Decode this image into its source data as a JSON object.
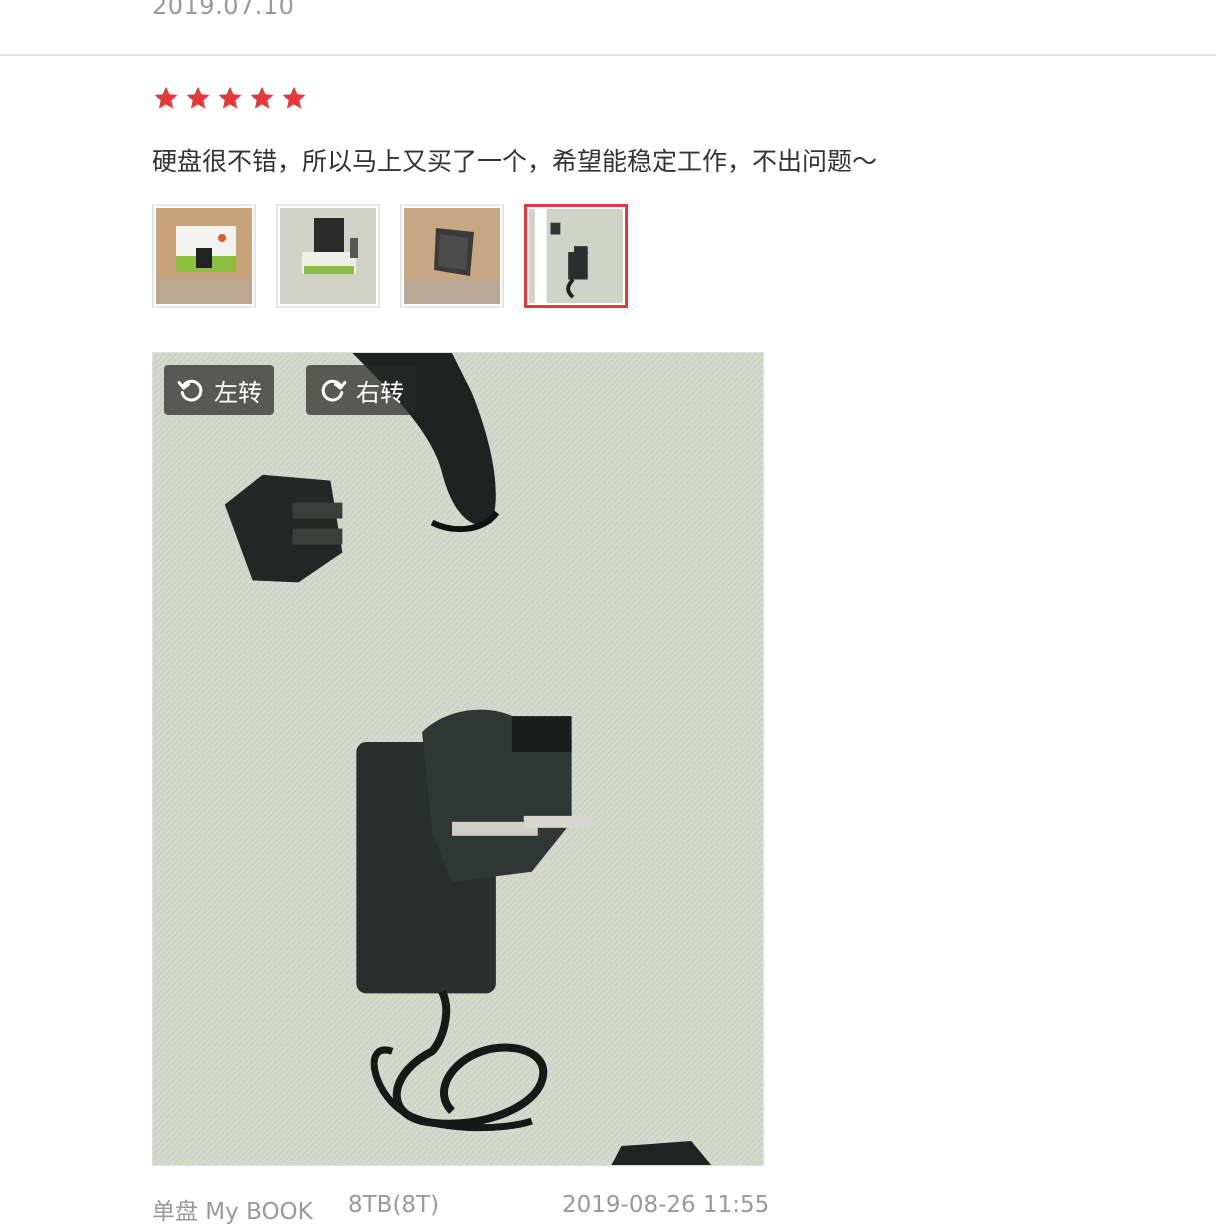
{
  "previous_review": {
    "date": "2019.07.10"
  },
  "review": {
    "rating": 5,
    "star_color": "#e4393c",
    "text": "硬盘很不错，所以马上又买了一个，希望能稳定工作，不出问题～",
    "thumbnails": [
      {
        "name": "thumb-box-front",
        "selected": false
      },
      {
        "name": "thumb-drive-stand",
        "selected": false
      },
      {
        "name": "thumb-drive-closeup",
        "selected": false
      },
      {
        "name": "thumb-power-adapter",
        "selected": true
      }
    ],
    "viewer": {
      "rotate_left_label": "左转",
      "rotate_right_label": "右转"
    },
    "meta": {
      "model": "单盘 My BOOK",
      "size": "8TB(8T)",
      "datetime": "2019-08-26 11:55"
    }
  }
}
